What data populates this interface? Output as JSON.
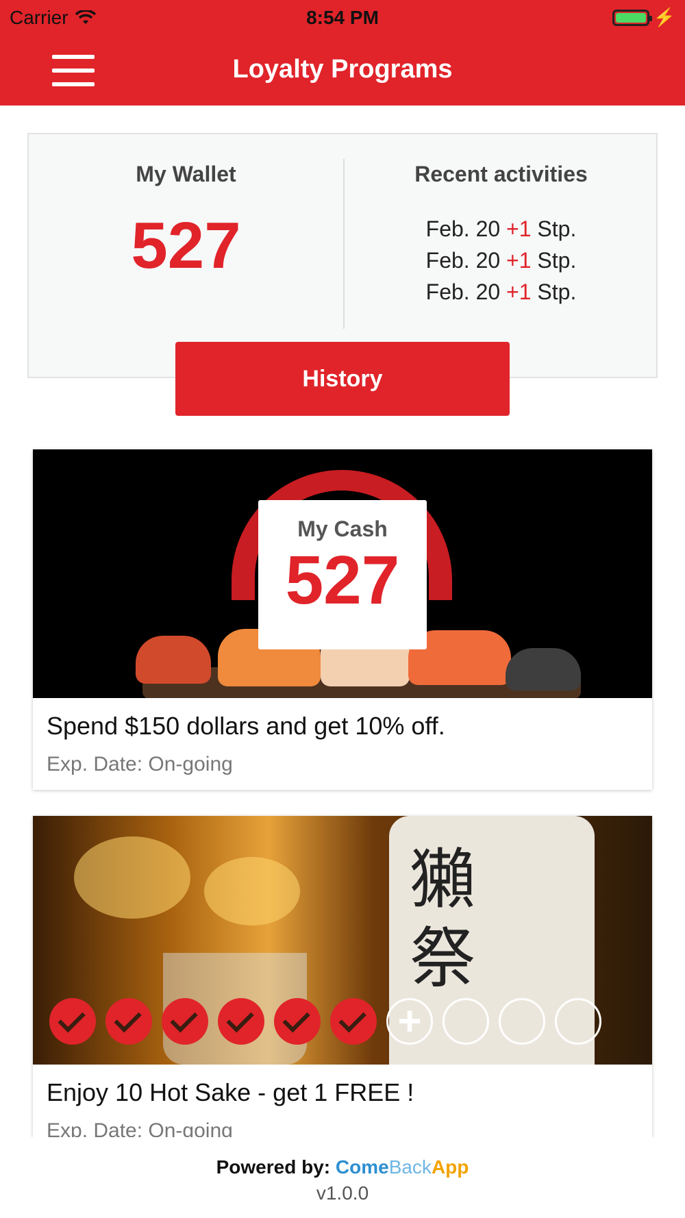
{
  "status_bar": {
    "carrier": "Carrier",
    "time": "8:54 PM",
    "icons": [
      "wifi-icon",
      "battery-icon",
      "charging-icon"
    ]
  },
  "nav": {
    "title": "Loyalty Programs",
    "menu_icon": "hamburger-menu-icon"
  },
  "wallet": {
    "heading": "My Wallet",
    "amount": "527",
    "recent_heading": "Recent activities",
    "activities": [
      {
        "date": "Feb. 20",
        "points": "+1",
        "unit": "Stp."
      },
      {
        "date": "Feb. 20",
        "points": "+1",
        "unit": "Stp."
      },
      {
        "date": "Feb. 20",
        "points": "+1",
        "unit": "Stp."
      }
    ],
    "history_label": "History"
  },
  "offers": [
    {
      "cash_label": "My Cash",
      "cash_amount": "527",
      "title": "Spend $150 dollars and get 10% off.",
      "exp": "Exp. Date: On-going"
    },
    {
      "title": "Enjoy 10 Hot Sake - get 1 FREE !",
      "exp": "Exp. Date: On-going",
      "stamps": {
        "total": 10,
        "collected": 6,
        "add_symbol": "+"
      }
    }
  ],
  "footer": {
    "powered_by": "Powered by:",
    "brand_come": "Come",
    "brand_back": "Back",
    "brand_app": "App",
    "version": "v1.0.0"
  },
  "colors": {
    "brand_red": "#e0242a",
    "brand_blue": "#2e8fd0",
    "brand_light_blue": "#6fb6e3",
    "brand_orange": "#f2a300"
  }
}
